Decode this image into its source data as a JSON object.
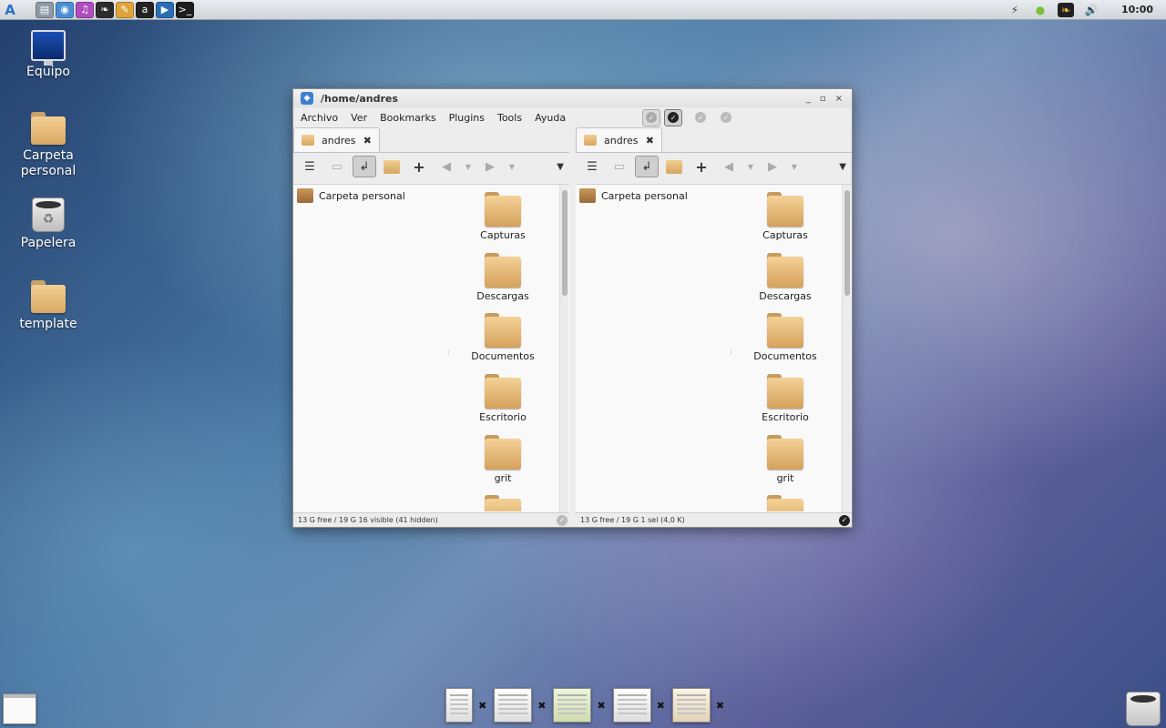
{
  "top_panel": {
    "launcher_icon": "arch-logo-icon",
    "quick_launch": [
      {
        "name": "files-icon",
        "color": "#8d9aa6",
        "glyph": "▤"
      },
      {
        "name": "browser-icon",
        "color": "#4a8fd6",
        "glyph": "◉"
      },
      {
        "name": "media-icon",
        "color": "#b04dbe",
        "glyph": "♫"
      },
      {
        "name": "leaf-icon",
        "color": "#2d2d2d",
        "glyph": "❧"
      },
      {
        "name": "paint-icon",
        "color": "#e0a43a",
        "glyph": "✎"
      },
      {
        "name": "amazon-icon",
        "color": "#222222",
        "glyph": "a"
      },
      {
        "name": "video-icon",
        "color": "#2a6fb6",
        "glyph": "▶"
      },
      {
        "name": "terminal-icon",
        "color": "#1e1e1e",
        "glyph": ">_"
      }
    ],
    "tray": [
      {
        "name": "network-icon",
        "glyph": "⚡"
      },
      {
        "name": "status-green-icon",
        "glyph": "●"
      },
      {
        "name": "leaf-tray-icon",
        "glyph": "❧"
      },
      {
        "name": "volume-icon",
        "glyph": "🔊"
      }
    ],
    "clock": "10:00"
  },
  "desktop_icons": {
    "equipo": "Equipo",
    "carpeta_personal_l1": "Carpeta",
    "carpeta_personal_l2": "personal",
    "papelera": "Papelera",
    "template": "template"
  },
  "window": {
    "title": "/home/andres",
    "controls": [
      "_",
      "▫",
      "×"
    ],
    "menu": [
      "Archivo",
      "Ver",
      "Bookmarks",
      "Plugins",
      "Tools",
      "Ayuda"
    ],
    "panes": [
      {
        "tab_label": "andres",
        "sidebar_entry": "Carpeta personal",
        "files": [
          "Capturas",
          "Descargas",
          "Documentos",
          "Escritorio",
          "grit"
        ],
        "status": "13 G free / 19 G   16 visible (41 hidden)"
      },
      {
        "tab_label": "andres",
        "sidebar_entry": "Carpeta personal",
        "files": [
          "Capturas",
          "Descargas",
          "Documentos",
          "Escritorio",
          "grit"
        ],
        "status": "13 G free / 19 G   1 sel (4,0 K)"
      }
    ]
  },
  "colors": {
    "accent_blue": "#3f7fcf",
    "folder": "#e6b878"
  }
}
